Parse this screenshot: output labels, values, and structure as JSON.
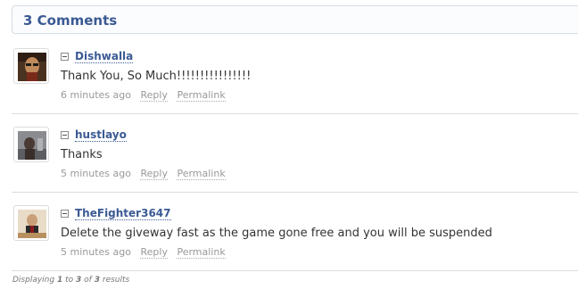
{
  "header": {
    "title": "3 Comments"
  },
  "comments": [
    {
      "author": "Dishwalla",
      "text": "Thank You, So Much!!!!!!!!!!!!!!!!",
      "time": "6 minutes ago",
      "reply": "Reply",
      "permalink": "Permalink",
      "avatar_icon": "avatar-dishwalla"
    },
    {
      "author": "hustlayo",
      "text": "Thanks",
      "time": "5 minutes ago",
      "reply": "Reply",
      "permalink": "Permalink",
      "avatar_icon": "avatar-hustlayo"
    },
    {
      "author": "TheFighter3647",
      "text": "Delete the giveway fast as the game gone free and you will be suspended",
      "time": "5 minutes ago",
      "reply": "Reply",
      "permalink": "Permalink",
      "avatar_icon": "avatar-thefighter3647"
    }
  ],
  "footer": {
    "prefix": "Displaying",
    "start": "1",
    "to": "to",
    "end": "3",
    "of": "of",
    "total": "3",
    "suffix": "results"
  },
  "colors": {
    "accent": "#3b5a94",
    "muted": "#999999",
    "divider": "#dcdcdc"
  }
}
